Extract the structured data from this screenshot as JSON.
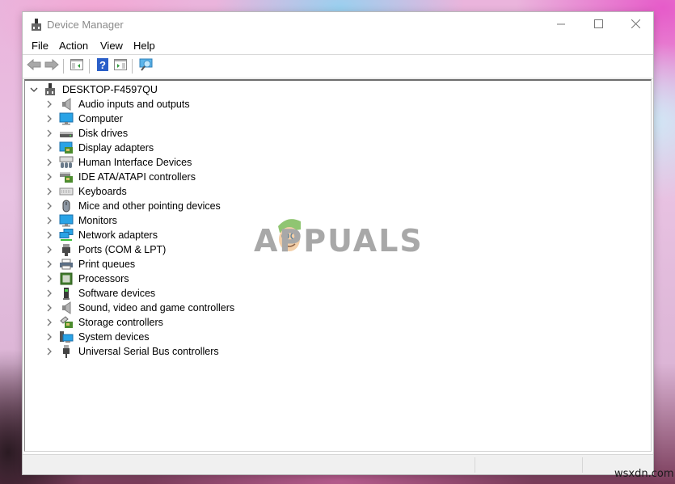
{
  "window": {
    "title": "Device Manager",
    "controls": {
      "minimize": "minimize",
      "maximize": "maximize",
      "close": "close"
    }
  },
  "menu": [
    "File",
    "Action",
    "View",
    "Help"
  ],
  "toolbar": {
    "buttons": [
      {
        "name": "back",
        "icon": "arrow-left-icon"
      },
      {
        "name": "forward",
        "icon": "arrow-right-icon"
      },
      {
        "name": "show-hide-console-tree",
        "icon": "console-tree-icon"
      },
      {
        "name": "help",
        "icon": "help-icon"
      },
      {
        "name": "show-hide-action-pane",
        "icon": "action-pane-icon"
      },
      {
        "name": "scan-for-hardware-changes",
        "icon": "scan-hardware-icon"
      }
    ]
  },
  "tree": {
    "root": {
      "label": "DESKTOP-F4597QU",
      "expanded": true
    },
    "categories": [
      {
        "label": "Audio inputs and outputs",
        "icon": "speaker-icon"
      },
      {
        "label": "Computer",
        "icon": "computer-icon"
      },
      {
        "label": "Disk drives",
        "icon": "disk-drive-icon"
      },
      {
        "label": "Display adapters",
        "icon": "display-adapter-icon"
      },
      {
        "label": "Human Interface Devices",
        "icon": "hid-icon"
      },
      {
        "label": "IDE ATA/ATAPI controllers",
        "icon": "ide-controller-icon"
      },
      {
        "label": "Keyboards",
        "icon": "keyboard-icon"
      },
      {
        "label": "Mice and other pointing devices",
        "icon": "mouse-icon"
      },
      {
        "label": "Monitors",
        "icon": "monitor-icon"
      },
      {
        "label": "Network adapters",
        "icon": "network-adapter-icon"
      },
      {
        "label": "Ports (COM & LPT)",
        "icon": "port-icon"
      },
      {
        "label": "Print queues",
        "icon": "printer-icon"
      },
      {
        "label": "Processors",
        "icon": "processor-icon"
      },
      {
        "label": "Software devices",
        "icon": "software-device-icon"
      },
      {
        "label": "Sound, video and game controllers",
        "icon": "speaker-icon"
      },
      {
        "label": "Storage controllers",
        "icon": "storage-controller-icon"
      },
      {
        "label": "System devices",
        "icon": "system-devices-icon"
      },
      {
        "label": "Universal Serial Bus controllers",
        "icon": "usb-icon"
      }
    ]
  },
  "statusbar": {
    "panes": [
      "",
      "",
      ""
    ]
  },
  "overlays": {
    "logo_text": "APPUALS",
    "watermark": "wsxdn.com"
  },
  "colors": {
    "title_text": "#8a8a8a",
    "accent_blue": "#1e90d8",
    "chip_green": "#4c8c2e"
  }
}
